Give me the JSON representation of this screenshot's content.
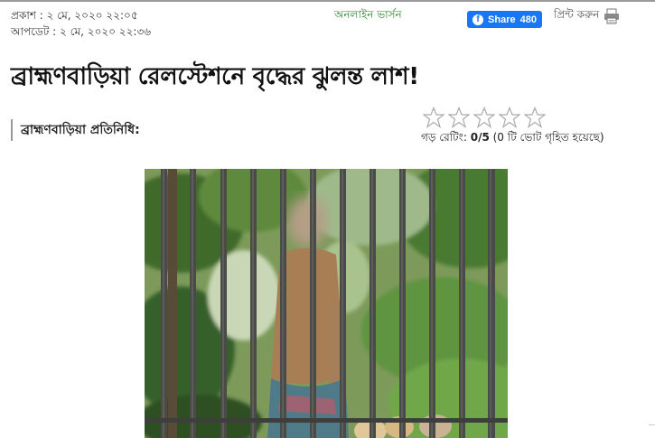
{
  "meta": {
    "published": "প্রকাশ : ২ মে, ২০২০ ২২:০৫",
    "updated": "আপডেট : ২ মে, ২০২০ ২২:৩৬"
  },
  "edition": "অনলাইন ভার্সন",
  "share": {
    "label": "Share",
    "count": "480",
    "icon": "facebook-icon",
    "color": "#1877f2"
  },
  "print": {
    "label": "প্রিন্ট করুন",
    "icon": "printer-icon"
  },
  "article": {
    "headline": "ব্রাহ্মণবাড়িয়া রেলস্টেশনে বৃদ্ধের ঝুলন্ত লাশ!",
    "byline": "ব্রাহ্মণবাড়িয়া প্রতিনিধি:"
  },
  "rating": {
    "max_stars": 5,
    "filled_stars": 0,
    "prefix": "গড় রেটিং: ",
    "value": "0/5",
    "suffix": " (0 টি ভোট গৃহিত হয়েছে)"
  },
  "photo": {
    "icon": "article-photo",
    "blurred_subject": true
  }
}
